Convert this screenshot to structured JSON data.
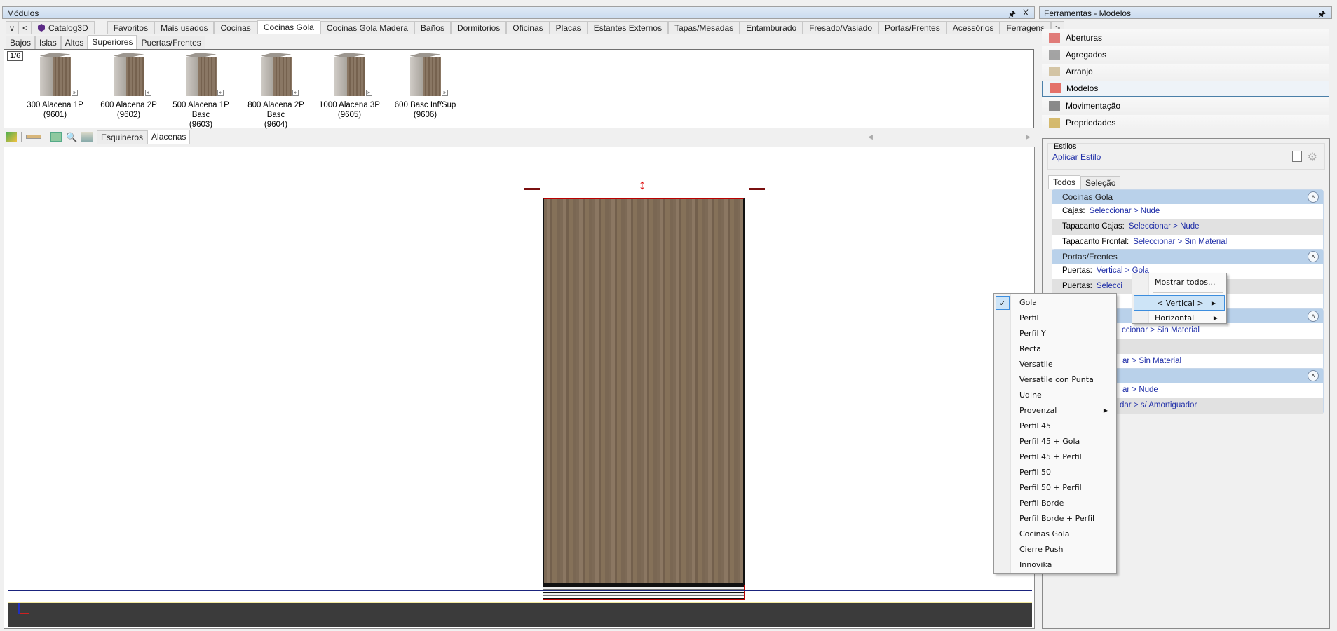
{
  "modules_panel": {
    "title": "Módulos",
    "pin": "↕",
    "close": "X",
    "nav_down": "v",
    "nav_left": "<",
    "nav_right": ">",
    "tabs": [
      "Catalog3D",
      "Favoritos",
      "Mais usados",
      "Cocinas",
      "Cocinas Gola",
      "Cocinas Gola Madera",
      "Baños",
      "Dormitorios",
      "Oficinas",
      "Placas",
      "Estantes Externos",
      "Tapas/Mesadas",
      "Entamburado",
      "Fresado/Vasiado",
      "Portas/Frentes",
      "Acessórios",
      "Ferragens"
    ],
    "selected_tab": "Cocinas Gola",
    "subtabs": [
      "Bajos",
      "Islas",
      "Altos",
      "Superiores",
      "Puertas/Frentes"
    ],
    "selected_subtab": "Superiores",
    "page_indicator": "1/6",
    "items": [
      {
        "name": "300 Alacena 1P",
        "code": "(9601)"
      },
      {
        "name": "600 Alacena 2P",
        "code": "(9602)"
      },
      {
        "name": "500 Alacena 1P Basc",
        "code": "(9603)"
      },
      {
        "name": "800 Alacena 2P Basc",
        "code": "(9604)"
      },
      {
        "name": "1000 Alacena 3P",
        "code": "(9605)"
      },
      {
        "name": "600 Basc Inf/Sup",
        "code": "(9606)"
      }
    ],
    "toolbar_tabs": [
      "Esquineros",
      "Alacenas"
    ]
  },
  "tools_panel": {
    "title": "Ferramentas - Modelos",
    "items": [
      {
        "label": "Aberturas",
        "icon": "aberturas-icon"
      },
      {
        "label": "Agregados",
        "icon": "agregados-icon"
      },
      {
        "label": "Arranjo",
        "icon": "arranjo-icon"
      },
      {
        "label": "Modelos",
        "icon": "modelos-icon"
      },
      {
        "label": "Movimentação",
        "icon": "move-icon"
      },
      {
        "label": "Propriedades",
        "icon": "properties-icon"
      }
    ],
    "selected": "Modelos",
    "styles": {
      "label": "Estilos",
      "apply": "Aplicar Estilo",
      "tabs": [
        "Todos",
        "Seleção"
      ],
      "groups": [
        {
          "title": "Cocinas Gola",
          "rows": [
            {
              "label": "Cajas:",
              "value": "Seleccionar > Nude"
            },
            {
              "label": "Tapacanto Cajas:",
              "value": "Seleccionar > Nude"
            },
            {
              "label": "Tapacanto Frontal:",
              "value": "Seleccionar > Sin Material"
            }
          ]
        },
        {
          "title": "Portas/Frentes",
          "rows": [
            {
              "label": "Puertas:",
              "value": "Vertical > Gola"
            },
            {
              "label": "Puertas:",
              "value": "Selecci"
            },
            {
              "label": "",
              "value": ""
            }
          ]
        },
        {
          "title": "",
          "rows": [
            {
              "label": "",
              "value": "ccionar > Sin Material"
            },
            {
              "label": "",
              "value": ""
            },
            {
              "label": "",
              "value": "ar > Sin Material"
            }
          ]
        },
        {
          "title": "",
          "rows": [
            {
              "label": "",
              "value": "ar > Nude"
            },
            {
              "label": "",
              "value": "dar > s/ Amortiguador"
            }
          ]
        }
      ]
    }
  },
  "context_menu": {
    "items": [
      {
        "label": "Mostrar todos..."
      },
      {
        "label": "< Vertical >",
        "submenu": true,
        "highlighted": true
      },
      {
        "label": "Horizontal",
        "submenu": true
      }
    ]
  },
  "submenu": {
    "checked": "Gola",
    "items": [
      "Gola",
      "Perfil",
      "Perfil Y",
      "Recta",
      "Versatile",
      "Versatile con Punta",
      "Udine",
      "Provenzal",
      "Perfil 45",
      "Perfil 45 + Gola",
      "Perfil 45 + Perfil",
      "Perfil 50",
      "Perfil 50 + Perfil",
      "Perfil Borde",
      "Perfil Borde + Perfil",
      "Cocinas Gola",
      "Cierre Push",
      "Innovika"
    ],
    "has_submenu": [
      "Provenzal"
    ]
  },
  "colors": {
    "accent": "#cde4f7",
    "link": "#1f2ea8",
    "header": "#b9d1ea"
  }
}
